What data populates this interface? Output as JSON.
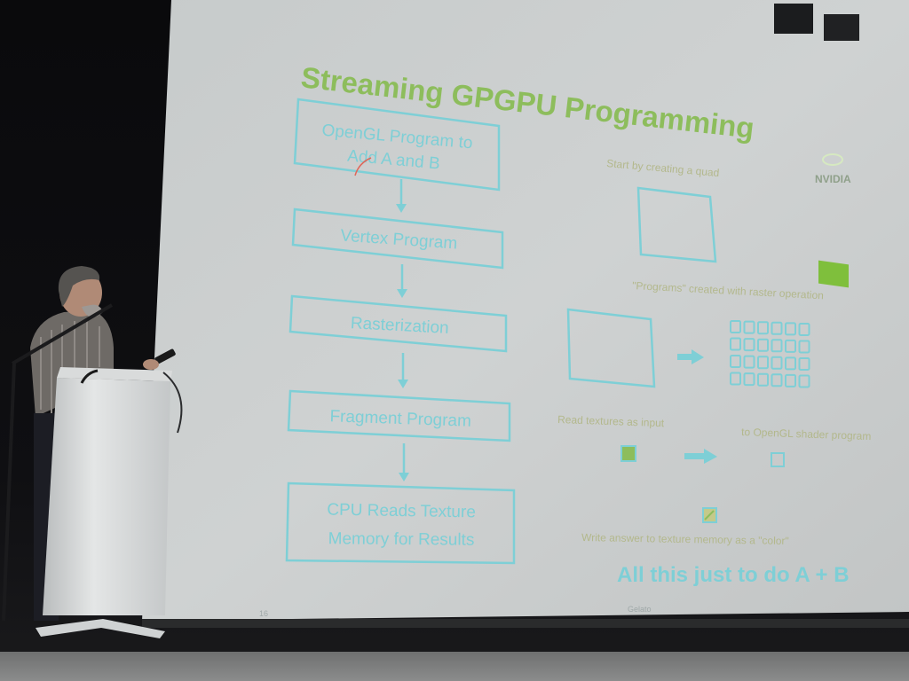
{
  "slide": {
    "title": "Streaming GPGPU Programming",
    "logo_text": "NVIDIA",
    "flow_steps": [
      {
        "line1": "OpenGL Program to",
        "line2": "Add A and B"
      },
      {
        "line1": "Vertex Program",
        "line2": ""
      },
      {
        "line1": "Rasterization",
        "line2": ""
      },
      {
        "line1": "Fragment Program",
        "line2": ""
      },
      {
        "line1": "CPU Reads Texture",
        "line2": "Memory for Results"
      }
    ],
    "notes": {
      "quad": "Start by creating a quad",
      "programs": "\"Programs\" created with raster operation",
      "read": "Read textures as input",
      "shader": "to OpenGL shader program",
      "write": "Write answer to texture memory as a \"color\""
    },
    "punchline": "All this just to do A + B",
    "page_number": "16",
    "footer_center": "Gelato",
    "colors": {
      "title_green": "#8dbd5c",
      "cyan": "#7ecfd6",
      "note_olive": "#b3b88c",
      "screen": "#c9cccc"
    }
  }
}
